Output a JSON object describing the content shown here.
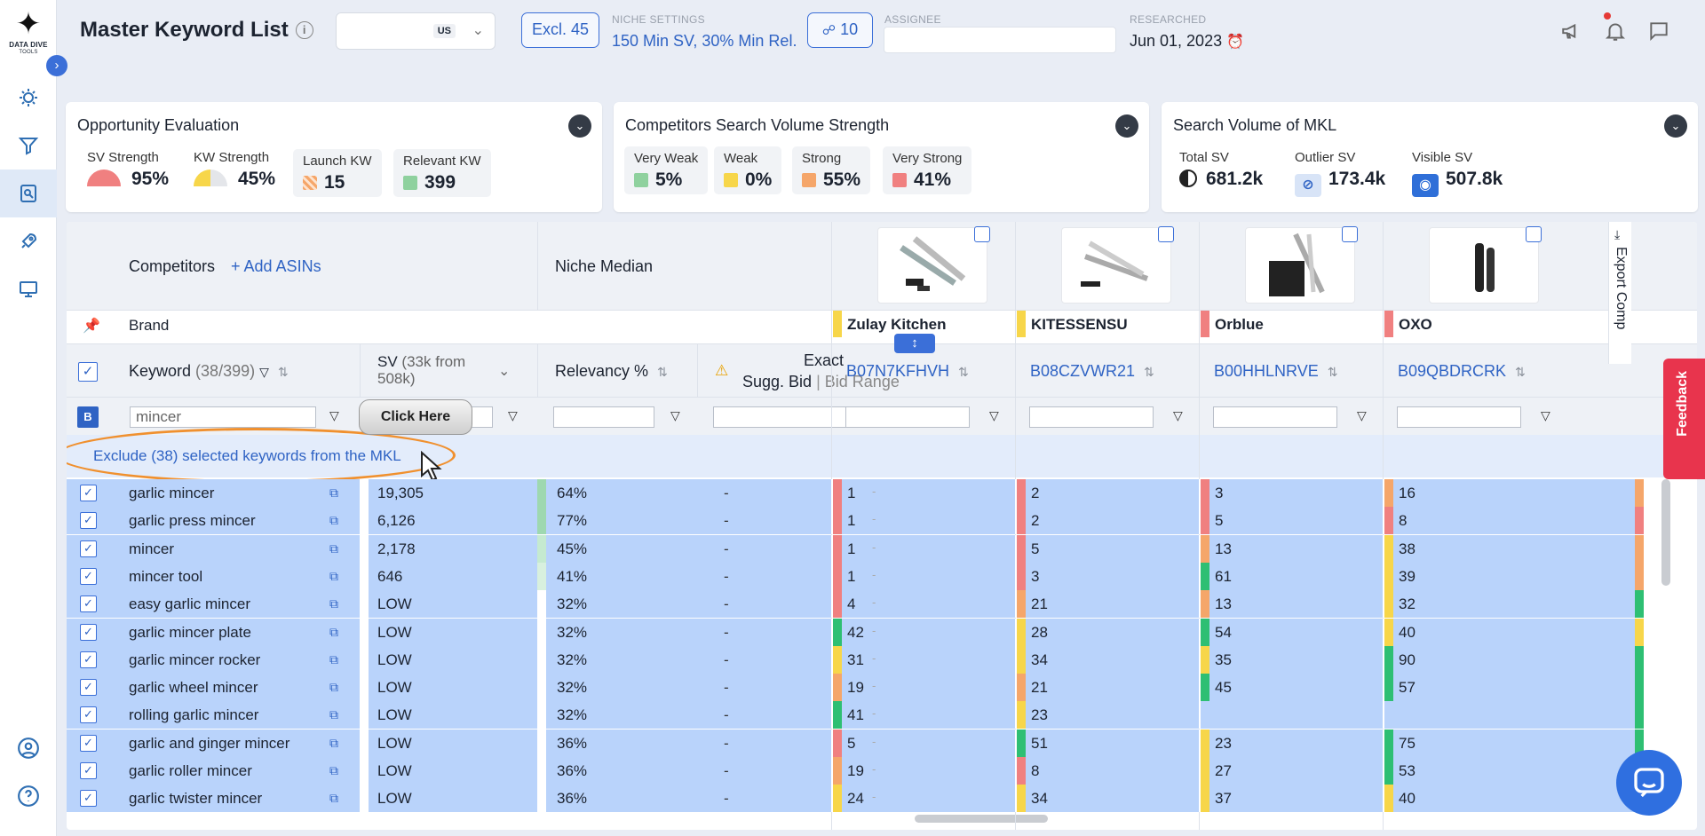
{
  "app": {
    "logo_text": "DATA DIVE",
    "logo_sub": "TOOLS"
  },
  "header": {
    "title": "Master Keyword List",
    "marketplace": "US",
    "excl_label": "Excl. 45",
    "niche_settings_label": "NICHE SETTINGS",
    "niche_settings_value": "150 Min SV, 30% Min Rel.",
    "share_count": "10",
    "assignee_label": "ASSIGNEE",
    "researched_label": "RESEARCHED",
    "researched_date": "Jun 01, 2023"
  },
  "cards": {
    "opportunity": {
      "title": "Opportunity Evaluation",
      "sv_label": "SV Strength",
      "sv_value": "95%",
      "kw_label": "KW Strength",
      "kw_value": "45%",
      "launch_label": "Launch KW",
      "launch_value": "15",
      "relevant_label": "Relevant KW",
      "relevant_value": "399"
    },
    "competitors": {
      "title": "Competitors Search Volume Strength",
      "items": [
        {
          "label": "Very Weak",
          "value": "5%",
          "color": "#8fd19e"
        },
        {
          "label": "Weak",
          "value": "0%",
          "color": "#f7d64a"
        },
        {
          "label": "Strong",
          "value": "55%",
          "color": "#f5a66a"
        },
        {
          "label": "Very Strong",
          "value": "41%",
          "color": "#f08080"
        }
      ]
    },
    "search_volume": {
      "title": "Search Volume of MKL",
      "total_label": "Total SV",
      "total_value": "681.2k",
      "outlier_label": "Outlier SV",
      "outlier_value": "173.4k",
      "visible_label": "Visible SV",
      "visible_value": "507.8k"
    }
  },
  "table": {
    "competitors_label": "Competitors",
    "add_asins": "+ Add ASINs",
    "niche_median": "Niche Median",
    "brand_label": "Brand",
    "brands": [
      "Zulay Kitchen",
      "KITESSENSU",
      "Orblue",
      "OXO"
    ],
    "brand_colors": [
      "#f7d64a",
      "#f7d64a",
      "#f08080",
      "#f08080"
    ],
    "asins": [
      "B07N7KFHVH",
      "B08CZVWR21",
      "B00HHLNRVE",
      "B09QBDRCRK"
    ],
    "keyword_header": "Keyword",
    "keyword_count": "(38/399)",
    "sv_header": "SV",
    "sv_sub": "(33k from 508k)",
    "relevancy_header": "Relevancy %",
    "bid_header_1": "Exact",
    "bid_header_2": "Sugg. Bid",
    "bid_range": "Bid Range",
    "filter_keyword": "mincer",
    "b_badge": "B",
    "exclude_text": "Exclude (38) selected keywords from the MKL",
    "tooltip": "Click Here",
    "export_label": "Export Comp",
    "feedback_label": "Feedback",
    "rows": [
      {
        "kw": "garlic mincer",
        "sv": "19,305",
        "rel": "64%",
        "r": [
          "1",
          "2",
          "3",
          "16"
        ],
        "c": [
          "#f08080",
          "#f08080",
          "#f08080",
          "#f5a66a"
        ],
        "relc": "#9ed8b0"
      },
      {
        "kw": "garlic press mincer",
        "sv": "6,126",
        "rel": "77%",
        "r": [
          "1",
          "2",
          "5",
          "8"
        ],
        "c": [
          "#f08080",
          "#f08080",
          "#f08080",
          "#f08080"
        ],
        "relc": "#9ed8b0"
      },
      {
        "kw": "mincer",
        "sv": "2,178",
        "rel": "45%",
        "r": [
          "1",
          "5",
          "13",
          "38"
        ],
        "c": [
          "#f08080",
          "#f08080",
          "#f5a66a",
          "#f7d64a"
        ],
        "relc": "#c5ead0"
      },
      {
        "kw": "mincer tool",
        "sv": "646",
        "rel": "41%",
        "r": [
          "1",
          "3",
          "61",
          "39"
        ],
        "c": [
          "#f08080",
          "#f08080",
          "#2ebf73",
          "#f7d64a"
        ],
        "relc": "#d8f0de"
      },
      {
        "kw": "easy garlic mincer",
        "sv": "LOW",
        "rel": "32%",
        "r": [
          "4",
          "21",
          "13",
          "32"
        ],
        "c": [
          "#f08080",
          "#f5a66a",
          "#f5a66a",
          "#f7d64a"
        ],
        "relc": "#ffffff"
      },
      {
        "kw": "garlic mincer plate",
        "sv": "LOW",
        "rel": "32%",
        "r": [
          "42",
          "28",
          "54",
          "40"
        ],
        "c": [
          "#2ebf73",
          "#f7d64a",
          "#2ebf73",
          "#f7d64a"
        ],
        "relc": "#ffffff"
      },
      {
        "kw": "garlic mincer rocker",
        "sv": "LOW",
        "rel": "32%",
        "r": [
          "31",
          "34",
          "35",
          "90"
        ],
        "c": [
          "#f7d64a",
          "#f7d64a",
          "#f7d64a",
          "#2ebf73"
        ],
        "relc": "#ffffff"
      },
      {
        "kw": "garlic wheel mincer",
        "sv": "LOW",
        "rel": "32%",
        "r": [
          "19",
          "21",
          "45",
          "57"
        ],
        "c": [
          "#f5a66a",
          "#f5a66a",
          "#2ebf73",
          "#2ebf73"
        ],
        "relc": "#ffffff"
      },
      {
        "kw": "rolling garlic mincer",
        "sv": "LOW",
        "rel": "32%",
        "r": [
          "41",
          "23",
          "",
          ""
        ],
        "c": [
          "#2ebf73",
          "#f7d64a",
          "",
          ""
        ],
        "relc": "#ffffff"
      },
      {
        "kw": "garlic and ginger mincer",
        "sv": "LOW",
        "rel": "36%",
        "r": [
          "5",
          "51",
          "23",
          "75"
        ],
        "c": [
          "#f08080",
          "#2ebf73",
          "#f7d64a",
          "#2ebf73"
        ],
        "relc": "#ffffff"
      },
      {
        "kw": "garlic roller mincer",
        "sv": "LOW",
        "rel": "36%",
        "r": [
          "19",
          "8",
          "27",
          "53"
        ],
        "c": [
          "#f5a66a",
          "#f08080",
          "#f7d64a",
          "#2ebf73"
        ],
        "relc": "#ffffff"
      },
      {
        "kw": "garlic twister mincer",
        "sv": "LOW",
        "rel": "36%",
        "r": [
          "24",
          "34",
          "37",
          "40"
        ],
        "c": [
          "#f7d64a",
          "#f7d64a",
          "#f7d64a",
          "#f7d64a"
        ],
        "relc": "#ffffff"
      }
    ]
  }
}
